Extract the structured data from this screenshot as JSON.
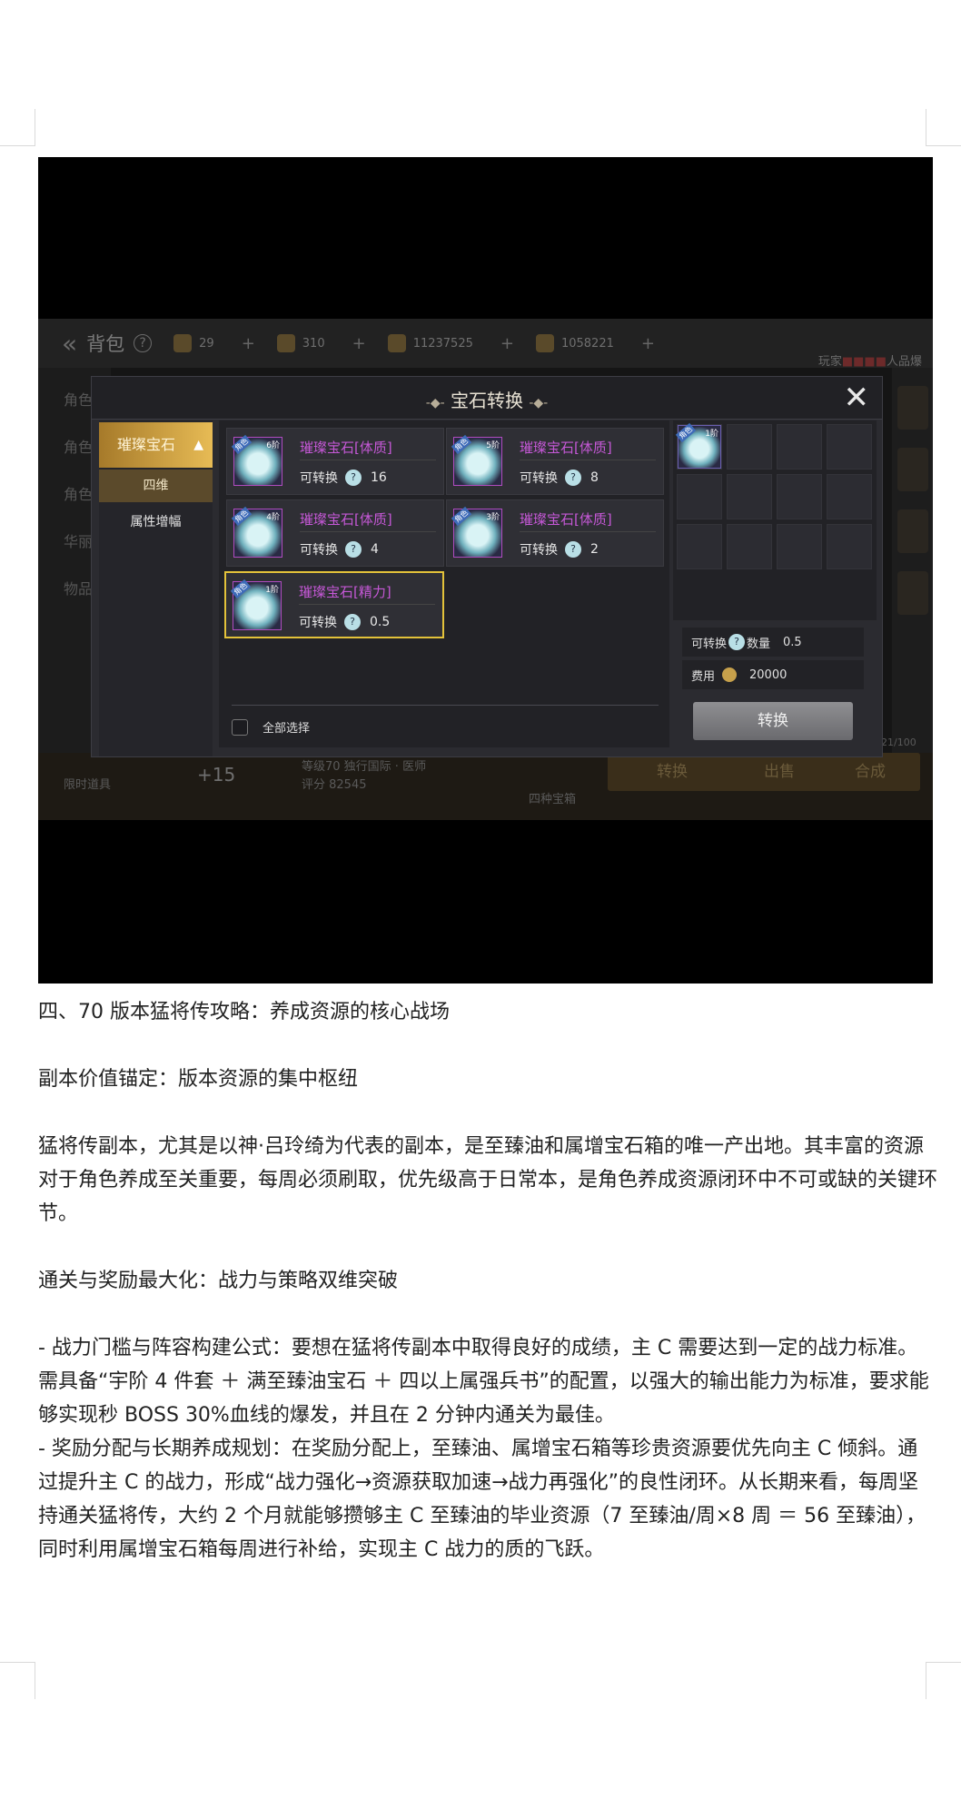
{
  "game": {
    "topbar": {
      "title": "背包",
      "help": "?",
      "resources": [
        "29",
        "310",
        "11237525",
        "1058221"
      ],
      "player_prefix": "玩家",
      "player_suffix": "人品爆"
    },
    "side_left": [
      "角色",
      "角色",
      "角色",
      "华丽",
      "物品"
    ],
    "bottom": {
      "left_label": "限时道具",
      "boost": "+15",
      "middle_text": "等级70  独行国际 · 医师",
      "score_text": "评分 82545",
      "right_label": "四种宝箱",
      "buttons": [
        "转换",
        "出售",
        "合成"
      ],
      "count": "21/100"
    }
  },
  "dialog": {
    "title": "宝石转换",
    "close": "✕",
    "category_main": "璀璨宝石",
    "category_sub_selected": "四维",
    "category_sub": "属性增幅",
    "conv_label": "可转换",
    "items": [
      {
        "name": "璀璨宝石[体质]",
        "tier": "6阶",
        "amount": "16"
      },
      {
        "name": "璀璨宝石[体质]",
        "tier": "5阶",
        "amount": "8"
      },
      {
        "name": "璀璨宝石[体质]",
        "tier": "4阶",
        "amount": "4"
      },
      {
        "name": "璀璨宝石[体质]",
        "tier": "3阶",
        "amount": "2"
      },
      {
        "name": "璀璨宝石[精力]",
        "tier": "1阶",
        "amount": "0.5"
      }
    ],
    "ribbon": "角色",
    "select_all": "全部选择",
    "slot_tier": "1阶",
    "conv_count_label": "可转换",
    "qty_label": "数量",
    "conv_count_value": "0.5",
    "cost_label": "费用",
    "cost_value": "20000",
    "convert_button": "转换"
  },
  "article": {
    "heading1": "四、70 版本猛将传攻略：养成资源的核心战场",
    "heading2": "副本价值锚定：版本资源的集中枢纽",
    "para1": "猛将传副本，尤其是以神·吕玲绮为代表的副本，是至臻油和属增宝石箱的唯一产出地。其丰富的资源对于角色养成至关重要，每周必须刷取，优先级高于日常本，是角色养成资源闭环中不可或缺的关键环节。",
    "heading3": "通关与奖励最大化：战力与策略双维突破",
    "bullet1": "- 战力门槛与阵容构建公式：要想在猛将传副本中取得良好的成绩，主 C 需要达到一定的战力标准。需具备“宇阶 4 件套 ＋ 满至臻油宝石 ＋ 四以上属强兵书”的配置，以强大的输出能力为标准，要求能够实现秒 BOSS 30%血线的爆发，并且在 2 分钟内通关为最佳。",
    "bullet2": "- 奖励分配与长期养成规划：在奖励分配上，至臻油、属增宝石箱等珍贵资源要优先向主 C 倾斜。通过提升主 C 的战力，形成“战力强化→资源获取加速→战力再强化”的良性闭环。从长期来看，每周坚持通关猛将传，大约 2 个月就能够攒够主 C 至臻油的毕业资源（7 至臻油/周×8 周 ＝ 56 至臻油），同时利用属增宝石箱每周进行补给，实现主 C 战力的质的飞跃。"
  }
}
